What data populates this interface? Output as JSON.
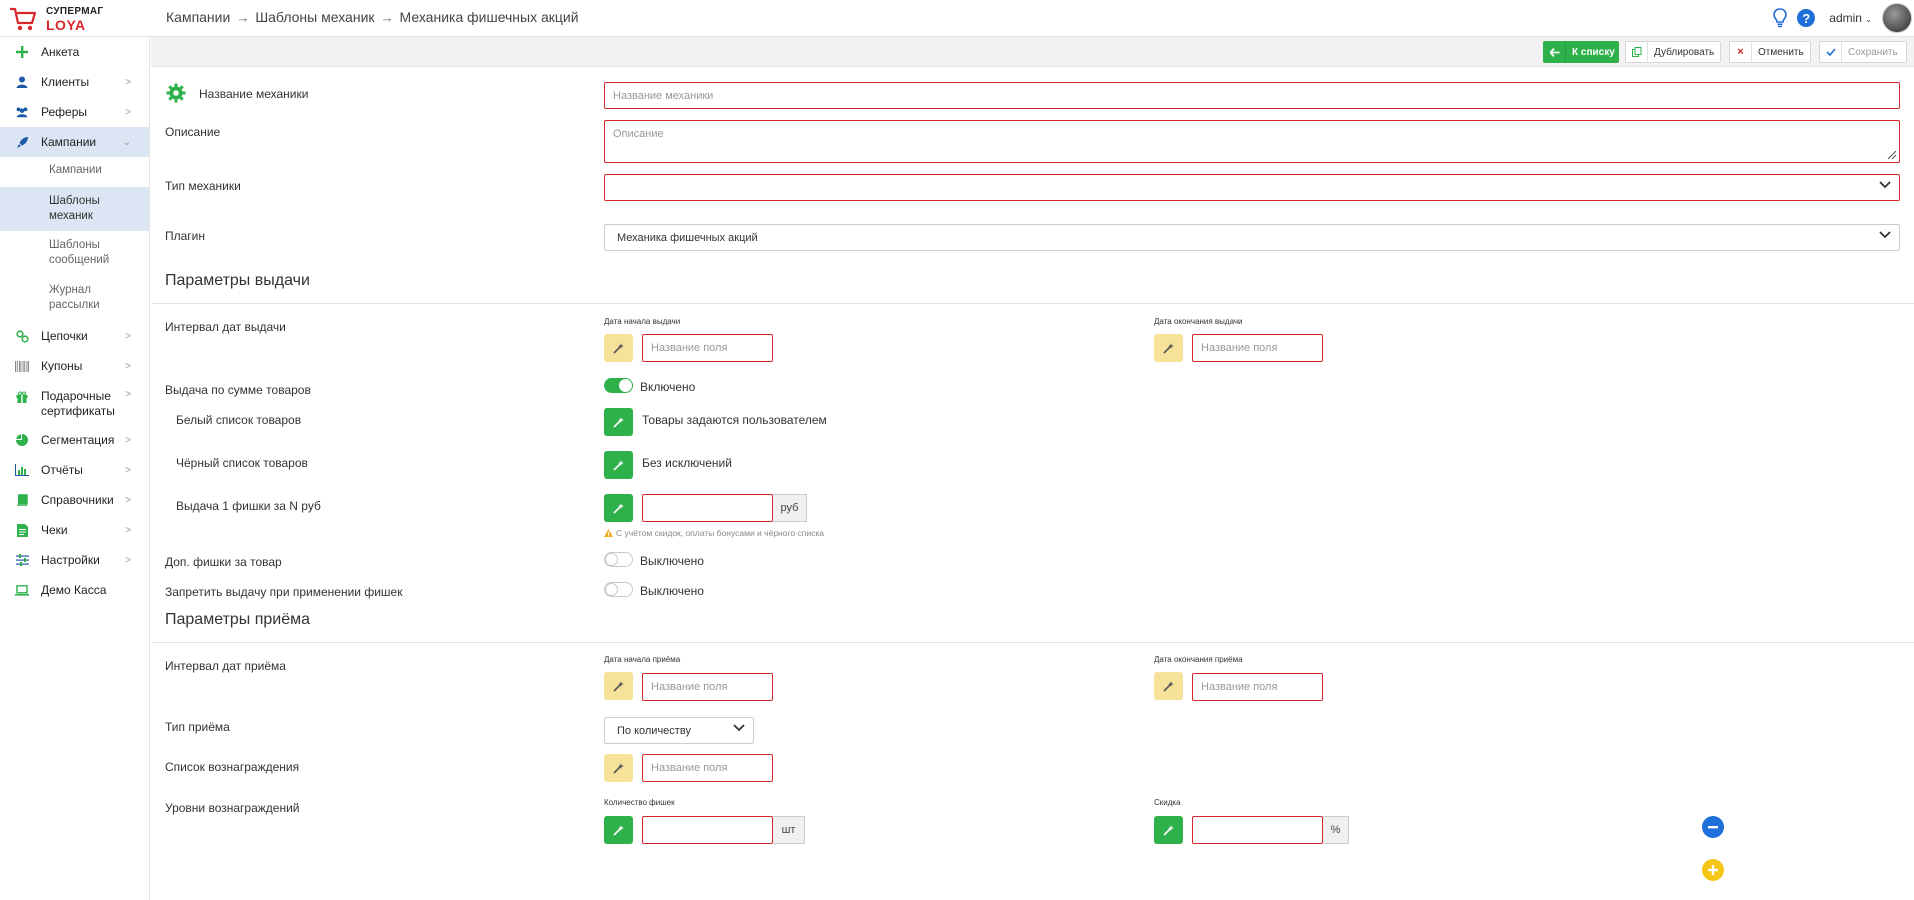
{
  "app": {
    "logo_line1": "СУПЕРМАГ",
    "logo_line2": "LOYA",
    "user": "admin",
    "accent": "#2eb14a",
    "error_border": "#d9262c"
  },
  "breadcrumb": [
    "Кампании",
    "Шаблоны механик",
    "Механика фишечных акций"
  ],
  "sidebar": {
    "items": [
      {
        "label": "Анкета",
        "icon": "plus-icon"
      },
      {
        "label": "Клиенты",
        "icon": "user-icon"
      },
      {
        "label": "Рефеpы",
        "icon": "users-icon"
      },
      {
        "label": "Кампании",
        "icon": "rocket-icon"
      },
      {
        "label": "Цепочки",
        "icon": "chain-icon"
      },
      {
        "label": "Купоны",
        "icon": "barcode-icon"
      },
      {
        "label": "Подарочные сертификаты",
        "icon": "gift-icon"
      },
      {
        "label": "Сегментация",
        "icon": "pie-icon"
      },
      {
        "label": "Отчёты",
        "icon": "chart-icon"
      },
      {
        "label": "Справочники",
        "icon": "book-icon"
      },
      {
        "label": "Чеки",
        "icon": "receipt-icon"
      },
      {
        "label": "Настройки",
        "icon": "sliders-icon"
      },
      {
        "label": "Демо Касса",
        "icon": "laptop-icon"
      }
    ],
    "sub_items": [
      "Кампании",
      "Шаблоны механик",
      "Шаблоны сообщений",
      "Журнал рассылки"
    ]
  },
  "toolbar": {
    "to_list": "К списку",
    "duplicate": "Дублировать",
    "cancel": "Отменить",
    "save": "Сохранить"
  },
  "form": {
    "name_label": "Название механики",
    "name_placeholder": "Название механики",
    "desc_label": "Описание",
    "desc_placeholder": "Описание",
    "type_label": "Тип механики",
    "type_value": "",
    "plugin_label": "Плагин",
    "plugin_value": "Механика фишечных акций"
  },
  "issue": {
    "title": "Параметры выдачи",
    "interval_label": "Интервал дат выдачи",
    "start_label": "Дата начала выдачи",
    "end_label": "Дата окончания выдачи",
    "field_placeholder": "Название поля",
    "by_sum_label": "Выдача по сумме товаров",
    "by_sum_state": "Включено",
    "whitelist_label": "Белый список товаров",
    "whitelist_value": "Товары задаются пользователем",
    "blacklist_label": "Чёрный список товаров",
    "blacklist_value": "Без исключений",
    "per_n_label": "Выдача 1 фишки за N руб",
    "per_n_unit": "руб",
    "per_n_hint": "С учётом скидок, оплаты бонусами и чёрного списка",
    "extra_label": "Доп. фишки за товар",
    "extra_state": "Выключено",
    "forbid_label": "Запретить выдачу при применении фишек",
    "forbid_state": "Выключено"
  },
  "accept": {
    "title": "Параметры приёма",
    "interval_label": "Интервал дат приёма",
    "start_label": "Дата начала приёма",
    "end_label": "Дата окончания приёма",
    "field_placeholder": "Название поля",
    "type_label": "Тип приёма",
    "type_value": "По количеству",
    "reward_list_label": "Список вознаграждения",
    "levels_label": "Уровни вознаграждений",
    "chips_label": "Количество фишек",
    "chips_unit": "шт",
    "discount_label": "Скидка",
    "discount_unit": "%"
  }
}
